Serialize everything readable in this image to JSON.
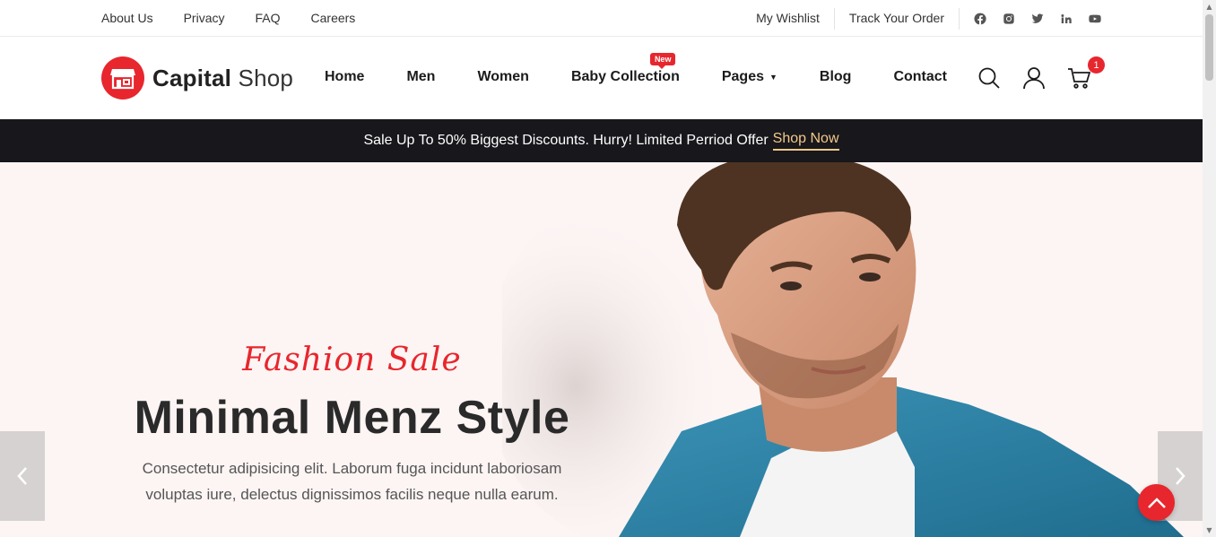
{
  "topbar": {
    "links": [
      "About Us",
      "Privacy",
      "FAQ",
      "Careers"
    ],
    "wishlist": "My Wishlist",
    "track_order": "Track Your Order",
    "socials": [
      "facebook-icon",
      "instagram-icon",
      "twitter-icon",
      "linkedin-icon",
      "youtube-icon"
    ]
  },
  "header": {
    "logo_bold": "Capital",
    "logo_light": "Shop",
    "nav": {
      "home": "Home",
      "men": "Men",
      "women": "Women",
      "baby": "Baby Collection",
      "baby_badge": "New",
      "pages": "Pages",
      "blog": "Blog",
      "contact": "Contact"
    },
    "cart_count": "1"
  },
  "promo": {
    "text": "Sale Up To 50% Biggest Discounts. Hurry! Limited Perriod Offer",
    "link": "Shop Now"
  },
  "hero": {
    "script": "Fashion Sale",
    "headline": "Minimal Menz Style",
    "description": "Consectetur adipisicing elit. Laborum fuga incidunt laboriosam voluptas iure, delectus dignissimos facilis neque nulla earum."
  },
  "colors": {
    "accent": "#e8262d",
    "promo_bg": "#17171c",
    "promo_link": "#f4c98a",
    "hero_bg": "#fcf5f4"
  }
}
